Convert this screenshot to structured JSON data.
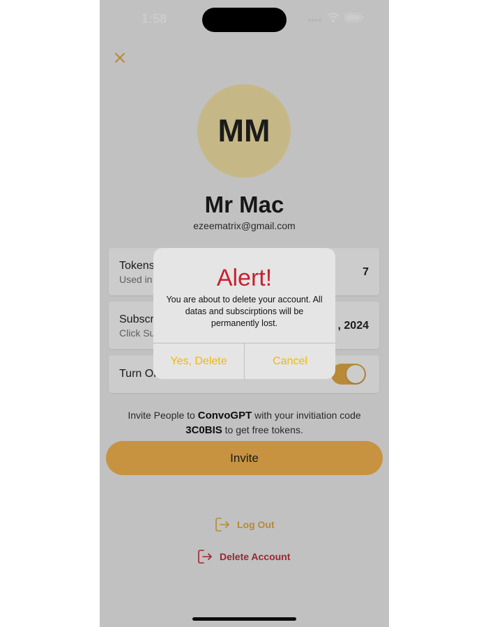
{
  "status_bar": {
    "time": "1:58"
  },
  "profile": {
    "initials": "MM",
    "name": "Mr Mac",
    "email": "ezeematrix@gmail.com"
  },
  "cards": {
    "tokens": {
      "title": "Tokens",
      "subtitle": "Used in",
      "value": "7"
    },
    "subscription": {
      "title": "Subscr",
      "subtitle": "Click Su",
      "value": ", 2024"
    },
    "toggle_row": {
      "title": "Turn On",
      "toggle_on": true
    }
  },
  "invite": {
    "line1_pre": "Invite People to ",
    "app_name": "ConvoGPT",
    "line1_post": " with your invitiation code",
    "code": "3C0BIS",
    "line2_post": " to get free tokens.",
    "button_label": "Invite"
  },
  "actions": {
    "logout_label": "Log Out",
    "delete_label": "Delete Account"
  },
  "alert": {
    "title": "Alert!",
    "message": "You are about to delete your account. All datas and subscirptions will be permanently lost.",
    "confirm_label": "Yes, Delete",
    "cancel_label": "Cancel"
  },
  "icons": {
    "close": "close-icon",
    "logout": "logout-icon",
    "delete": "delete-account-icon"
  },
  "colors": {
    "accent": "#e7ac45",
    "danger": "#c0303d",
    "alert_title": "#c7202f",
    "alert_button": "#f6b600"
  }
}
